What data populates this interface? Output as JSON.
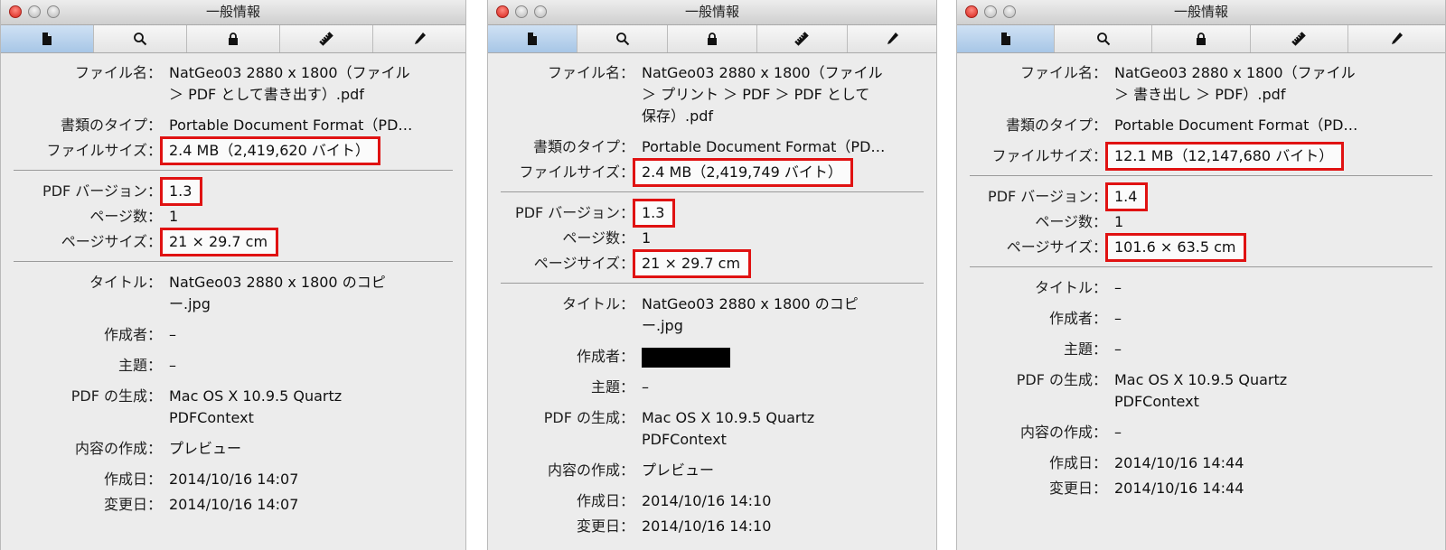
{
  "windows": [
    {
      "title": "一般情報",
      "toolbar": [
        "general-info-icon",
        "search-icon",
        "lock-icon",
        "ruler-icon",
        "pen-icon"
      ],
      "fields": {
        "filename": {
          "label": "ファイル名：",
          "value": "NatGeo03 2880 x 1800（ファイル\n＞ PDF として書き出す）.pdf"
        },
        "doctype": {
          "label": "書類のタイプ：",
          "value": "Portable Document Format（PD…"
        },
        "filesize": {
          "label": "ファイルサイズ：",
          "value": "2.4 MB（2,419,620 バイト）"
        },
        "pdfversion": {
          "label": "PDF バージョン：",
          "value": "1.3"
        },
        "pages": {
          "label": "ページ数：",
          "value": "1"
        },
        "pagesize": {
          "label": "ページサイズ：",
          "value": "21 × 29.7 cm"
        },
        "title": {
          "label": "タイトル：",
          "value": "NatGeo03 2880 x 1800 のコピ\nー.jpg"
        },
        "author": {
          "label": "作成者：",
          "value": "–"
        },
        "subject": {
          "label": "主題：",
          "value": "–"
        },
        "producer": {
          "label": "PDF の生成：",
          "value": "Mac OS X 10.9.5 Quartz\nPDFContext"
        },
        "creator": {
          "label": "内容の作成：",
          "value": "プレビュー"
        },
        "created": {
          "label": "作成日：",
          "value": "2014/10/16 14:07"
        },
        "modified": {
          "label": "変更日：",
          "value": "2014/10/16 14:07"
        }
      }
    },
    {
      "title": "一般情報",
      "toolbar": [
        "general-info-icon",
        "search-icon",
        "lock-icon",
        "ruler-icon",
        "pen-icon"
      ],
      "fields": {
        "filename": {
          "label": "ファイル名：",
          "value": "NatGeo03 2880 x 1800（ファイル\n＞ プリント ＞ PDF ＞ PDF として\n保存）.pdf"
        },
        "doctype": {
          "label": "書類のタイプ：",
          "value": "Portable Document Format（PD…"
        },
        "filesize": {
          "label": "ファイルサイズ：",
          "value": "2.4 MB（2,419,749 バイト）"
        },
        "pdfversion": {
          "label": "PDF バージョン：",
          "value": "1.3"
        },
        "pages": {
          "label": "ページ数：",
          "value": "1"
        },
        "pagesize": {
          "label": "ページサイズ：",
          "value": "21 × 29.7 cm"
        },
        "title": {
          "label": "タイトル：",
          "value": "NatGeo03 2880 x 1800 のコピ\nー.jpg"
        },
        "author": {
          "label": "作成者：",
          "value": ""
        },
        "subject": {
          "label": "主題：",
          "value": "–"
        },
        "producer": {
          "label": "PDF の生成：",
          "value": "Mac OS X 10.9.5 Quartz\nPDFContext"
        },
        "creator": {
          "label": "内容の作成：",
          "value": "プレビュー"
        },
        "created": {
          "label": "作成日：",
          "value": "2014/10/16 14:10"
        },
        "modified": {
          "label": "変更日：",
          "value": "2014/10/16 14:10"
        }
      }
    },
    {
      "title": "一般情報",
      "toolbar": [
        "general-info-icon",
        "search-icon",
        "lock-icon",
        "ruler-icon",
        "pen-icon"
      ],
      "fields": {
        "filename": {
          "label": "ファイル名：",
          "value": "NatGeo03 2880 x 1800（ファイル\n＞ 書き出し ＞ PDF）.pdf"
        },
        "doctype": {
          "label": "書類のタイプ：",
          "value": "Portable Document Format（PD…"
        },
        "filesize": {
          "label": "ファイルサイズ：",
          "value": "12.1 MB（12,147,680 バイト）"
        },
        "pdfversion": {
          "label": "PDF バージョン：",
          "value": "1.4"
        },
        "pages": {
          "label": "ページ数：",
          "value": "1"
        },
        "pagesize": {
          "label": "ページサイズ：",
          "value": "101.6 × 63.5 cm"
        },
        "title": {
          "label": "タイトル：",
          "value": "–"
        },
        "author": {
          "label": "作成者：",
          "value": "–"
        },
        "subject": {
          "label": "主題：",
          "value": "–"
        },
        "producer": {
          "label": "PDF の生成：",
          "value": "Mac OS X 10.9.5 Quartz\nPDFContext"
        },
        "creator": {
          "label": "内容の作成：",
          "value": "–"
        },
        "created": {
          "label": "作成日：",
          "value": "2014/10/16 14:44"
        },
        "modified": {
          "label": "変更日：",
          "value": "2014/10/16 14:44"
        }
      }
    }
  ],
  "colors": {
    "highlight_box": "#e01212",
    "active_tab": "#b7d2ee",
    "window_bg": "#ececec",
    "close_button": "#d7231b"
  }
}
